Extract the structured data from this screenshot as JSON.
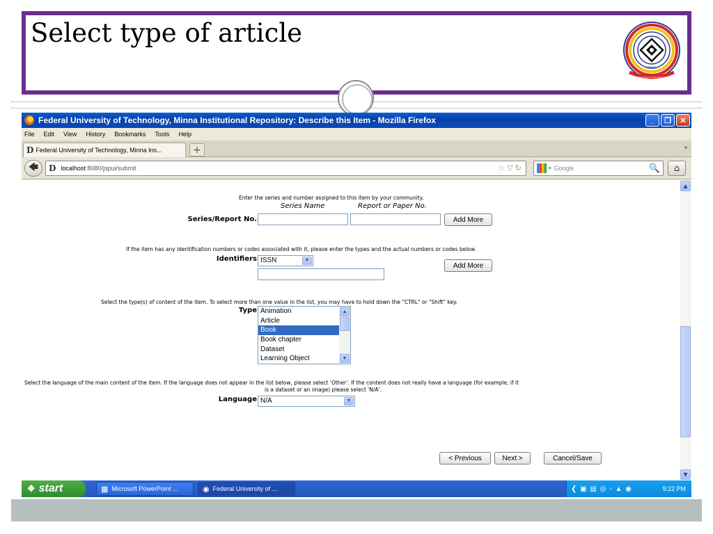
{
  "slide": {
    "title": "Select type of article",
    "logo": {
      "text_top": "FEDERAL UNIVERSITY OF TECHNOLOGY",
      "text_center": "MINNA",
      "motto": "Technology for Empowerment"
    }
  },
  "window": {
    "title": "Federal University of Technology, Minna Institutional Repository: Describe this Item - Mozilla Firefox",
    "controls": {
      "minimize": "_",
      "restore": "❐",
      "close": "✕"
    }
  },
  "menu": [
    "File",
    "Edit",
    "View",
    "History",
    "Bookmarks",
    "Tools",
    "Help"
  ],
  "tab": {
    "label": "Federal University of Technology, Minna Ins...",
    "favicon": "D",
    "new_tab": "+"
  },
  "nav": {
    "url_host": "localhost",
    "url_rest": ":8080/jspui/submit",
    "search_placeholder": "Google",
    "favicon": "D"
  },
  "form": {
    "series": {
      "instruction": "Enter the series and number assigned to this item by your community.",
      "col1": "Series Name",
      "col2": "Report or Paper No.",
      "label": "Series/Report No.",
      "series_value": "",
      "number_value": "",
      "add_more": "Add More"
    },
    "identifiers": {
      "instruction": "If the item has any identification numbers or codes associated with it, please enter the types and the actual numbers or codes below.",
      "label": "Identifiers",
      "type_selected": "ISSN",
      "value": "",
      "add_more": "Add More"
    },
    "type": {
      "instruction": "Select the type(s) of content of the item. To select more than one value in the list, you may have to hold down the \"CTRL\" or \"Shift\" key.",
      "label": "Type",
      "options": [
        "Animation",
        "Article",
        "Book",
        "Book chapter",
        "Dataset",
        "Learning Object"
      ],
      "selected": "Book"
    },
    "language": {
      "instruction_line1": "Select the language of the main content of the item. If the language does not appear in the list below, please select 'Other'. If the content does not really have a language (for example, if it",
      "instruction_line2": "is a dataset or an image) please select 'N/A'.",
      "label": "Language",
      "selected": "N/A"
    },
    "buttons": {
      "previous": "< Previous",
      "next": "Next >",
      "cancel": "Cancel/Save"
    }
  },
  "taskbar": {
    "start": "start",
    "tasks": [
      "Microsoft PowerPoint ...",
      "Federal University of ..."
    ],
    "clock": "9:22 PM"
  }
}
